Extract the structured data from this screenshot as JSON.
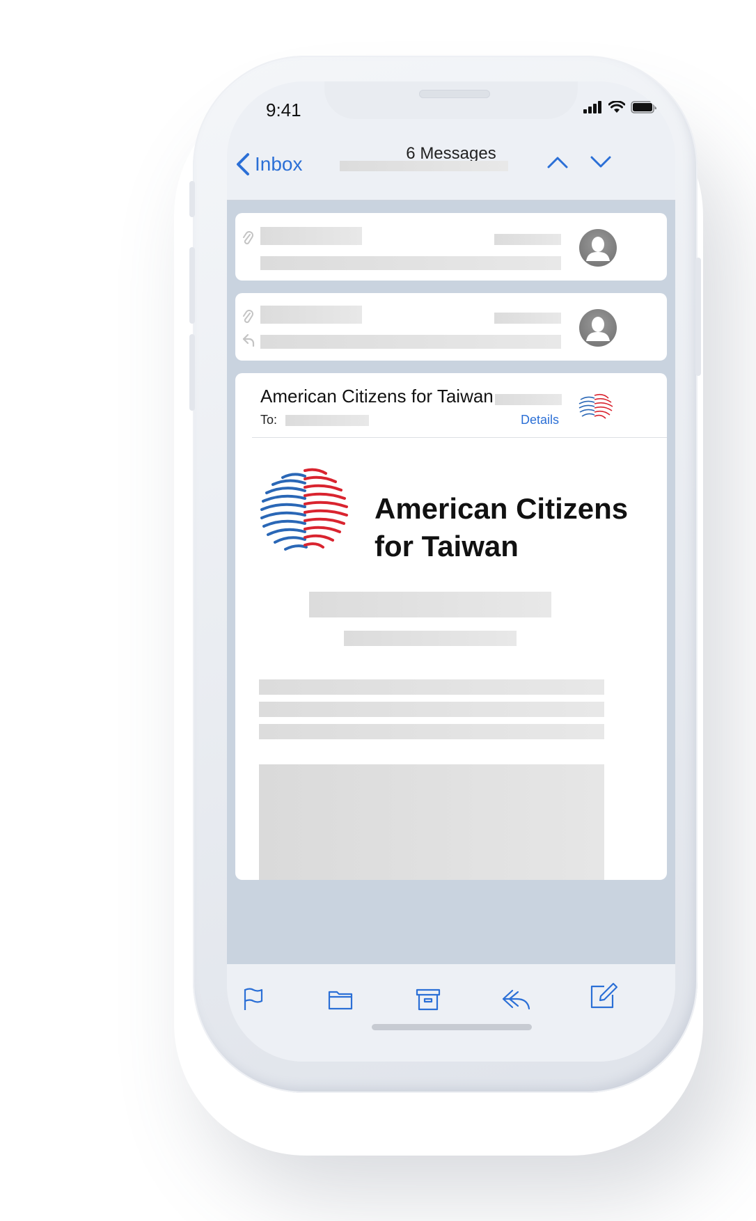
{
  "status_bar": {
    "time": "9:41"
  },
  "nav": {
    "back_label": "Inbox",
    "title": "6 Messages"
  },
  "email": {
    "sender": "American Citizens for Taiwan",
    "to_label": "To:",
    "details_link": "Details",
    "brand_line1": "American Citizens",
    "brand_line2": "for Taiwan"
  },
  "icons": {
    "status": [
      "signal-icon",
      "wifi-icon",
      "battery-icon"
    ],
    "nav": [
      "chevron-left-icon",
      "chevron-up-icon",
      "chevron-down-icon"
    ],
    "list": [
      "paperclip-icon",
      "reply-indicator-icon",
      "avatar-icon"
    ],
    "toolbar": [
      "flag-icon",
      "folder-icon",
      "archive-icon",
      "reply-icon",
      "compose-icon"
    ]
  },
  "colors": {
    "accent": "#2b6fd6",
    "logo_blue": "#2a67b6",
    "logo_red": "#d9242f"
  }
}
